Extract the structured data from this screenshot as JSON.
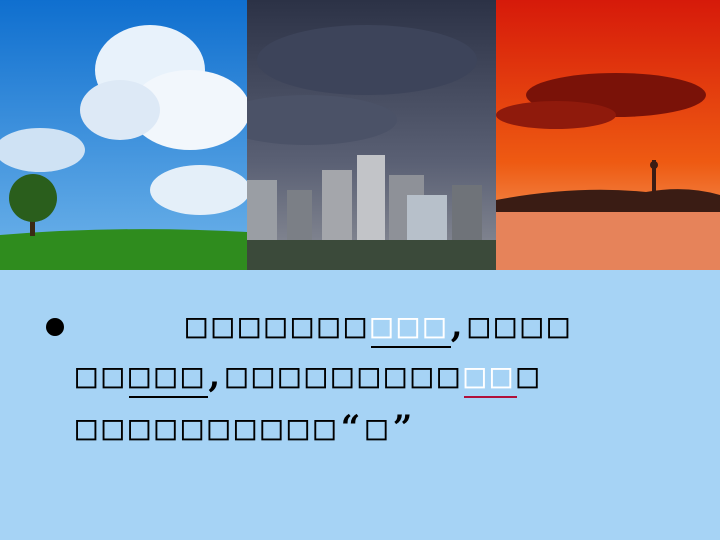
{
  "photos": [
    {
      "name": "sunny-field-photo",
      "colors": {
        "sky": "#1a7fd6",
        "grass": "#2e8a1f"
      }
    },
    {
      "name": "cloudy-city-photo",
      "colors": {
        "sky": "#3b4257",
        "city": "#8a8f96"
      }
    },
    {
      "name": "red-sunset-photo",
      "colors": {
        "sky": "#d8200d",
        "water": "#e0703c"
      }
    }
  ],
  "text": {
    "line1_a": "□□□□□□□",
    "line1_b": "□□□",
    "line1_c": ",",
    "line1_d": "□□□□",
    "line2_a": "□□",
    "line2_b": "□□□",
    "line2_c": ",",
    "line2_d": "□□□□□□□□□",
    "line2_e": "□□",
    "line2_f": "□",
    "line3_a": "□□□□□□□□□□",
    "line3_b": "“",
    "line3_c": "□",
    "line3_d": "”"
  },
  "colors": {
    "background": "#a6d3f5",
    "accent_red": "#b0103a"
  }
}
